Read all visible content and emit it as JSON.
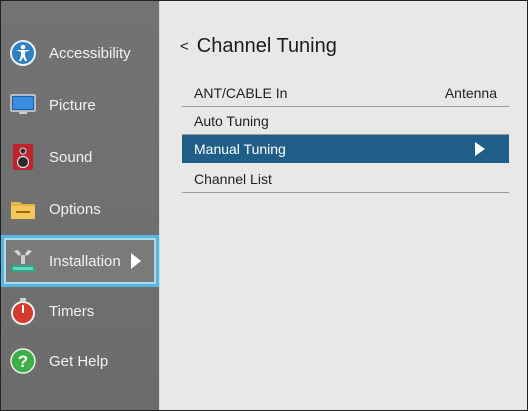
{
  "sidebar": {
    "items": [
      {
        "label": "Accessibility",
        "icon": "accessibility-icon"
      },
      {
        "label": "Picture",
        "icon": "picture-icon"
      },
      {
        "label": "Sound",
        "icon": "speaker-icon"
      },
      {
        "label": "Options",
        "icon": "options-icon"
      },
      {
        "label": "Installation",
        "icon": "installation-icon"
      },
      {
        "label": "Timers",
        "icon": "timer-icon"
      },
      {
        "label": "Get Help",
        "icon": "help-icon"
      }
    ],
    "selected_index": 4
  },
  "panel": {
    "back_glyph": "<",
    "title": "Channel Tuning",
    "rows": [
      {
        "label": "ANT/CABLE In",
        "value": "Antenna"
      },
      {
        "label": "Auto Tuning",
        "value": ""
      },
      {
        "label": "Manual Tuning",
        "value": ""
      },
      {
        "label": "Channel List",
        "value": ""
      }
    ],
    "highlighted_index": 2
  },
  "colors": {
    "sidebar_bg": "#737373",
    "selection_border": "#57b7de",
    "highlight_row": "#1f5e87",
    "panel_bg": "#e8e8e8"
  }
}
